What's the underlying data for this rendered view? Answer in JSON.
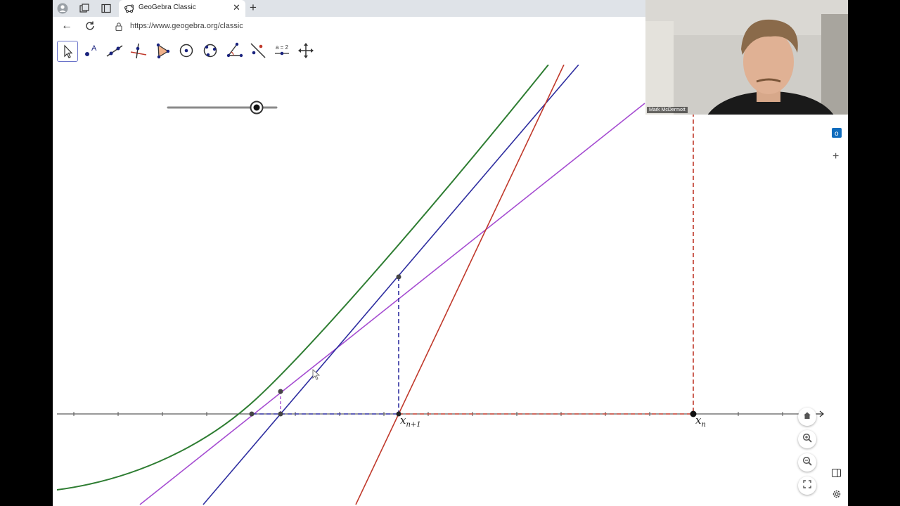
{
  "browser": {
    "tab_title": "GeoGebra Classic",
    "url": "https://www.geogebra.org/classic"
  },
  "toolbar": {
    "tools": [
      "move-tool",
      "point-tool",
      "line-tool",
      "perpendicular-tool",
      "polygon-tool",
      "circle-center-tool",
      "circle-three-points-tool",
      "angle-tool",
      "reflect-tool",
      "slider-tool",
      "move-graphics-tool"
    ],
    "slider_tool_label": "a = 2"
  },
  "graphics": {
    "labels": {
      "xn1_base": "x",
      "xn1_sub": "n+1",
      "xn_base": "x",
      "xn_sub": "n"
    },
    "colors": {
      "curve": "#2e7d32",
      "tangent_red": "#c0392b",
      "tangent_blue": "#2e2ea0",
      "secant_purple": "#a54cd1",
      "axis": "#333333"
    }
  },
  "webcam": {
    "name": "Mark McDermott"
  }
}
